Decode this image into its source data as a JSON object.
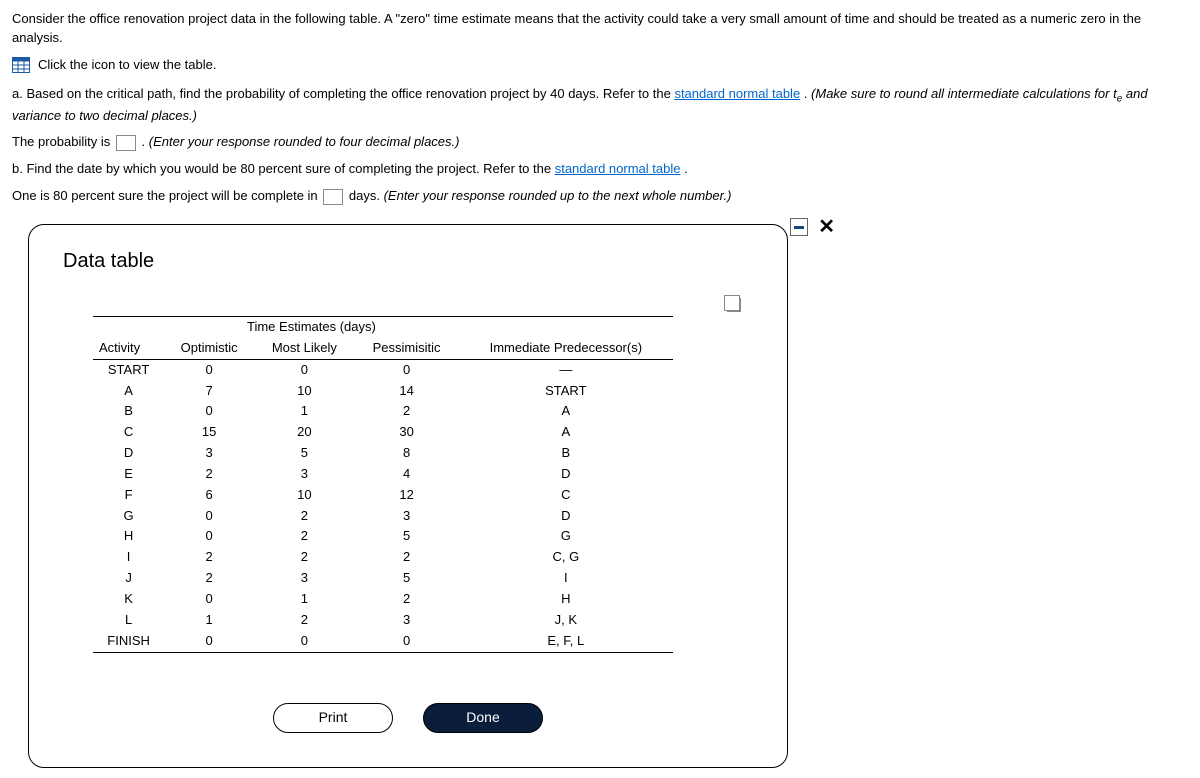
{
  "intro": {
    "line1": "Consider the office renovation project data in the following table. A \"zero\" time estimate means that the activity could take a very small amount of time and should be treated as a numeric zero in the analysis.",
    "view_table": "Click the icon to view the table."
  },
  "partA": {
    "prefix": "a. Based on the critical path, find the probability of completing the office renovation project by 40 days. Refer to the ",
    "link": "standard normal table",
    "suffix1": ". ",
    "note_open": "(Make sure to round all intermediate calculations for t",
    "note_sub": "e",
    "note_close": " and variance to two decimal places.)",
    "answer_lead": "The probability is ",
    "answer_trail": ". ",
    "answer_hint": "(Enter your response rounded to four decimal places.)"
  },
  "partB": {
    "prompt_pre": "b. Find the date by which you would be 80 percent sure of completing the project. Refer to the ",
    "prompt_link": "standard normal table",
    "prompt_post": ".",
    "answer_lead": "One is 80 percent sure the project will be complete in ",
    "answer_mid": " days. ",
    "answer_hint": "(Enter your response rounded up to the next whole number.)"
  },
  "modal": {
    "title": "Data table",
    "group_header": "Time Estimates (days)",
    "headers": {
      "activity": "Activity",
      "opt": "Optimistic",
      "ml": "Most Likely",
      "pes": "Pessimisitic",
      "pred": "Immediate Predecessor(s)"
    },
    "buttons": {
      "print": "Print",
      "done": "Done"
    }
  },
  "chart_data": {
    "type": "table",
    "title": "Time Estimates (days)",
    "columns": [
      "Activity",
      "Optimistic",
      "Most Likely",
      "Pessimisitic",
      "Immediate Predecessor(s)"
    ],
    "rows": [
      {
        "activity": "START",
        "opt": "0",
        "ml": "0",
        "pes": "0",
        "pred": "—"
      },
      {
        "activity": "A",
        "opt": "7",
        "ml": "10",
        "pes": "14",
        "pred": "START"
      },
      {
        "activity": "B",
        "opt": "0",
        "ml": "1",
        "pes": "2",
        "pred": "A"
      },
      {
        "activity": "C",
        "opt": "15",
        "ml": "20",
        "pes": "30",
        "pred": "A"
      },
      {
        "activity": "D",
        "opt": "3",
        "ml": "5",
        "pes": "8",
        "pred": "B"
      },
      {
        "activity": "E",
        "opt": "2",
        "ml": "3",
        "pes": "4",
        "pred": "D"
      },
      {
        "activity": "F",
        "opt": "6",
        "ml": "10",
        "pes": "12",
        "pred": "C"
      },
      {
        "activity": "G",
        "opt": "0",
        "ml": "2",
        "pes": "3",
        "pred": "D"
      },
      {
        "activity": "H",
        "opt": "0",
        "ml": "2",
        "pes": "5",
        "pred": "G"
      },
      {
        "activity": "I",
        "opt": "2",
        "ml": "2",
        "pes": "2",
        "pred": "C, G"
      },
      {
        "activity": "J",
        "opt": "2",
        "ml": "3",
        "pes": "5",
        "pred": "I"
      },
      {
        "activity": "K",
        "opt": "0",
        "ml": "1",
        "pes": "2",
        "pred": "H"
      },
      {
        "activity": "L",
        "opt": "1",
        "ml": "2",
        "pes": "3",
        "pred": "J, K"
      },
      {
        "activity": "FINISH",
        "opt": "0",
        "ml": "0",
        "pes": "0",
        "pred": "E, F, L"
      }
    ]
  }
}
